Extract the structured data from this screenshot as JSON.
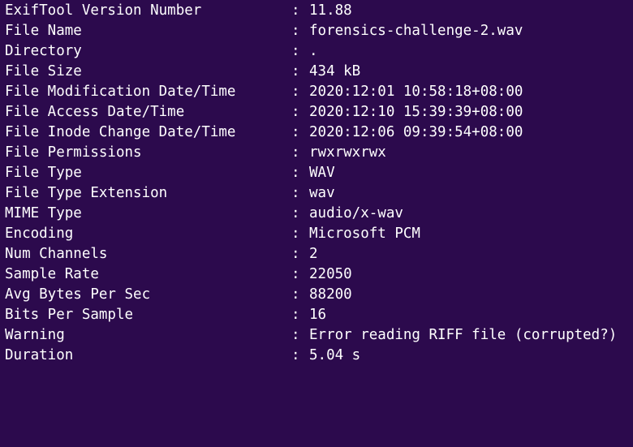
{
  "theme": {
    "background": "#2c0a4d",
    "foreground": "#ffffff"
  },
  "separator": ":",
  "rows": [
    {
      "key": "ExifTool Version Number",
      "value": "11.88"
    },
    {
      "key": "File Name",
      "value": "forensics-challenge-2.wav"
    },
    {
      "key": "Directory",
      "value": "."
    },
    {
      "key": "File Size",
      "value": "434 kB"
    },
    {
      "key": "File Modification Date/Time",
      "value": "2020:12:01 10:58:18+08:00"
    },
    {
      "key": "File Access Date/Time",
      "value": "2020:12:10 15:39:39+08:00"
    },
    {
      "key": "File Inode Change Date/Time",
      "value": "2020:12:06 09:39:54+08:00"
    },
    {
      "key": "File Permissions",
      "value": "rwxrwxrwx"
    },
    {
      "key": "File Type",
      "value": "WAV"
    },
    {
      "key": "File Type Extension",
      "value": "wav"
    },
    {
      "key": "MIME Type",
      "value": "audio/x-wav"
    },
    {
      "key": "Encoding",
      "value": "Microsoft PCM"
    },
    {
      "key": "Num Channels",
      "value": "2"
    },
    {
      "key": "Sample Rate",
      "value": "22050"
    },
    {
      "key": "Avg Bytes Per Sec",
      "value": "88200"
    },
    {
      "key": "Bits Per Sample",
      "value": "16"
    },
    {
      "key": "Warning",
      "value": "Error reading RIFF file (corrupted?)"
    },
    {
      "key": "Duration",
      "value": "5.04 s"
    }
  ]
}
